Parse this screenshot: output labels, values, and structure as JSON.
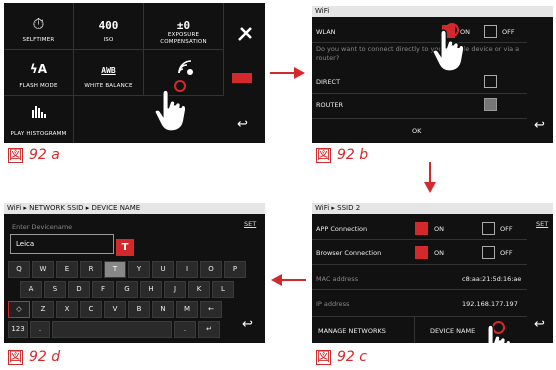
{
  "panel_a": {
    "tiles": [
      {
        "label": "SELFTIMER",
        "icon": "selftimer-icon",
        "glyph": "⏱"
      },
      {
        "label": "ISO",
        "value": "400"
      },
      {
        "label": "EXPOSURE COMPENSATION",
        "value": "±0"
      },
      {
        "label": "FLASH MODE",
        "icon": "flash-auto-icon",
        "glyph": "ϟA"
      },
      {
        "label": "WHITE BALANCE",
        "value": "AWB"
      },
      {
        "label": "",
        "icon": "wifi-icon",
        "glyph": "≋"
      },
      {
        "label": "PLAY HISTOGRAMM",
        "icon": "histogram-icon",
        "glyph": "▮▮▮"
      }
    ],
    "caption": "92 a"
  },
  "panel_b": {
    "title": "WiFi",
    "wlan_label": "WLAN",
    "on_label": "ON",
    "off_label": "OFF",
    "question": "Do you want to connect directly to your mobile device or via a router?",
    "direct_label": "DIRECT",
    "router_label": "ROUTER",
    "ok_label": "OK",
    "caption": "92 b"
  },
  "panel_c": {
    "title": "WiFi ▸ SSID 2",
    "set_label": "SET",
    "app_connection": "APP Connection",
    "browser_connection": "Browser Connection",
    "on_label": "ON",
    "off_label": "OFF",
    "mac_label": "MAC address",
    "mac_value": "c8:aa:21:5d:16:ae",
    "ip_label": "IP address",
    "ip_value": "192.168.177.197",
    "manage_networks": "MANAGE NETWORKS",
    "device_name": "DEVICE NAME",
    "caption": "92 c"
  },
  "panel_d": {
    "title": "WiFi ▸ NETWORK SSID ▸ DEVICE NAME",
    "set_label": "SET",
    "placeholder": "Enter Devicename",
    "value": "Leica",
    "popup_key": "T",
    "row1": [
      "Q",
      "W",
      "E",
      "R",
      "T",
      "Y",
      "U",
      "I",
      "O",
      "P"
    ],
    "row2": [
      "A",
      "S",
      "D",
      "F",
      "G",
      "H",
      "J",
      "K",
      "L"
    ],
    "row3": [
      "◇",
      "Z",
      "X",
      "C",
      "V",
      "B",
      "N",
      "M",
      "←"
    ],
    "num_key": "123",
    "dot_key": ".",
    "dot_key2": ".",
    "enter_key": "↵",
    "caption": "92 d"
  },
  "colors": {
    "accent": "#d4292c",
    "panel_bg": "#111111",
    "title_bar": "#e5e5e5"
  }
}
